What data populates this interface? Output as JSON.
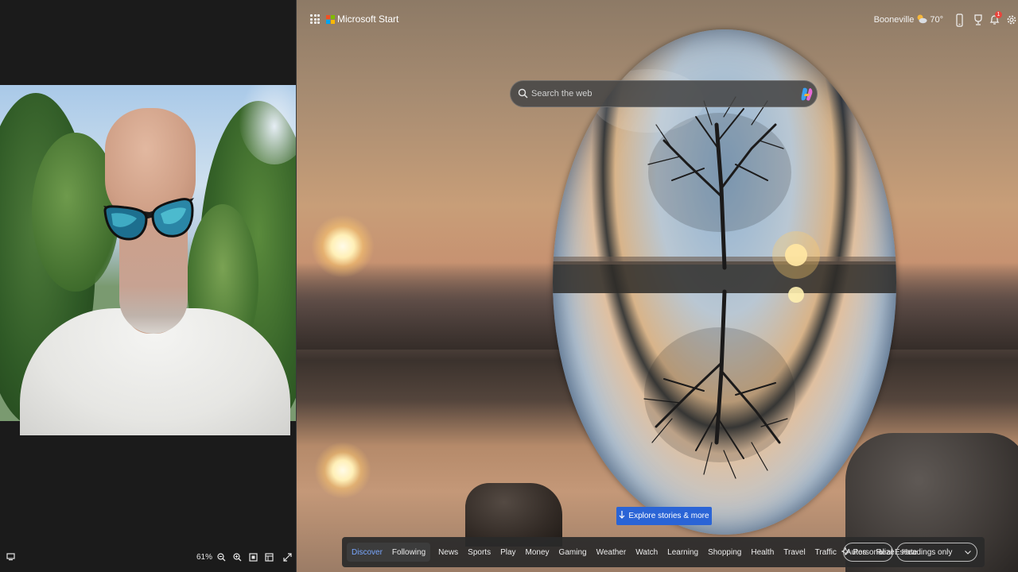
{
  "left_pane": {
    "zoom": "61%"
  },
  "browser": {
    "brand": "Microsoft Start",
    "weather": {
      "city": "Booneville",
      "temp": "70°"
    },
    "notification_count": "1",
    "search": {
      "placeholder": "Search the web"
    },
    "explore_label": "Explore stories & more",
    "nav": {
      "tabs": [
        "Discover",
        "Following"
      ],
      "items": [
        "News",
        "Sports",
        "Play",
        "Money",
        "Gaming",
        "Weather",
        "Watch",
        "Learning",
        "Shopping",
        "Health",
        "Travel",
        "Traffic",
        "Autos",
        "Real Estate"
      ]
    },
    "personalize_label": "Personalize",
    "headings_select": "Headings only"
  },
  "colors": {
    "accent_blue": "#2a64d6",
    "active_tab": "#79a7ff",
    "notification": "#e8453c"
  }
}
